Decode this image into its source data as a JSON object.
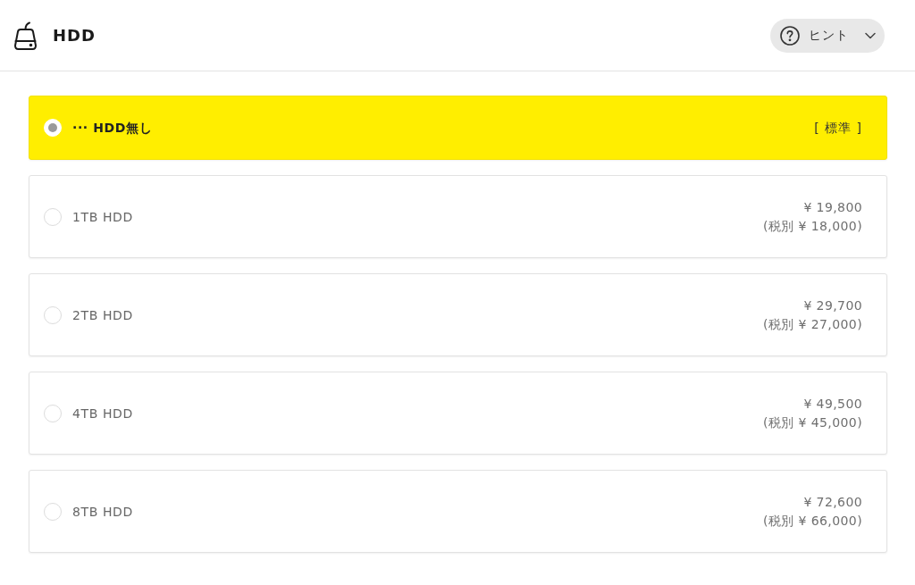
{
  "header": {
    "title": "HDD",
    "hint_button": {
      "label": "ヒント",
      "expanded": false
    }
  },
  "options": [
    {
      "kind": "standard",
      "label": "··· HDD無し",
      "selected": true,
      "badge": "[ 標準 ]"
    },
    {
      "kind": "priced",
      "label": "1TB HDD",
      "selected": false,
      "price": "¥ 19,800",
      "price_excl_tax": "(税別 ¥ 18,000)"
    },
    {
      "kind": "priced",
      "label": "2TB HDD",
      "selected": false,
      "price": "¥ 29,700",
      "price_excl_tax": "(税別 ¥ 27,000)"
    },
    {
      "kind": "priced",
      "label": "4TB HDD",
      "selected": false,
      "price": "¥ 49,500",
      "price_excl_tax": "(税別 ¥ 45,000)"
    },
    {
      "kind": "priced",
      "label": "8TB HDD",
      "selected": false,
      "price": "¥ 72,600",
      "price_excl_tax": "(税別 ¥ 66,000)"
    }
  ]
}
